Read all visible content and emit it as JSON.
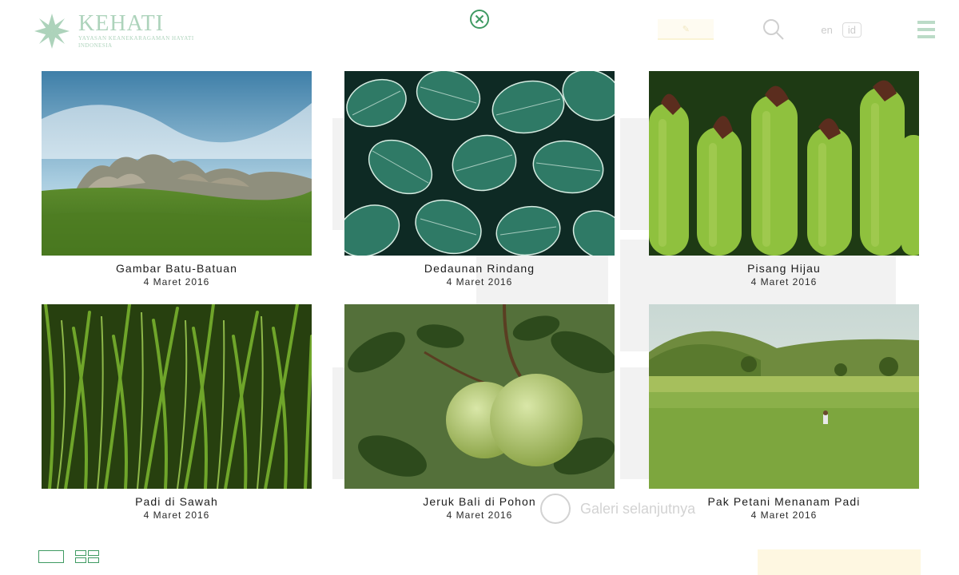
{
  "brand": {
    "name": "KEHATI",
    "tagline_line1": "YAYASAN KEANEKARAGAMAN HAYATI",
    "tagline_line2": "INDONESIA"
  },
  "background": {
    "lang_en": "en",
    "lang_id": "id",
    "next_gallery": "Galeri selanjutnya"
  },
  "gallery": {
    "items": [
      {
        "title": "Gambar Batu-Batuan",
        "date": "4 Maret 2016"
      },
      {
        "title": "Dedaunan Rindang",
        "date": "4 Maret 2016"
      },
      {
        "title": "Pisang Hijau",
        "date": "4 Maret 2016"
      },
      {
        "title": "Padi di Sawah",
        "date": "4 Maret 2016"
      },
      {
        "title": "Jeruk Bali di Pohon",
        "date": "4 Maret 2016"
      },
      {
        "title": "Pak Petani Menanam Padi",
        "date": "4 Maret 2016"
      }
    ]
  },
  "icons": {
    "close": "close-circle-icon",
    "search": "search-icon",
    "menu": "hamburger-menu-icon",
    "view_single": "single-view-icon",
    "view_grid": "grid-view-icon"
  },
  "colors": {
    "accent_green": "#3f9a62",
    "text_dark": "#1c1c1c"
  }
}
